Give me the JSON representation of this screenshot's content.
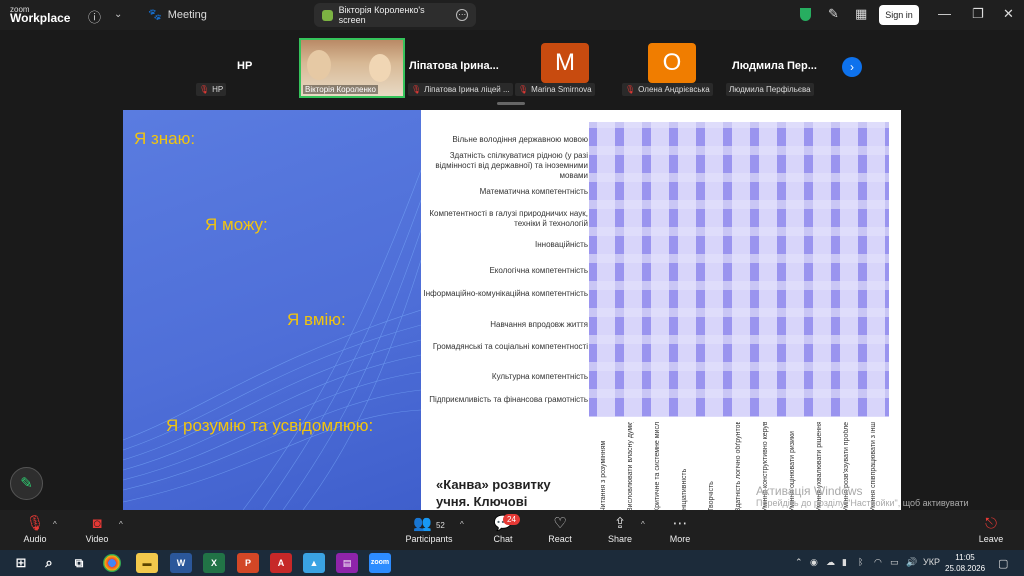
{
  "app": {
    "logo_top": "zoom",
    "logo_bottom": "Workplace",
    "meeting_label": "Meeting",
    "share_tab": "Вікторія Короленко's screen",
    "signin": "Sign in"
  },
  "participants": [
    {
      "tile_name": "HP",
      "tag": "HP"
    },
    {
      "tile_name": "",
      "tag": "Вікторія Короленко"
    },
    {
      "tile_name": "Ліпатова Ірина...",
      "tag": "Ліпатова Ірина ліцей ..."
    },
    {
      "tile_name": "",
      "tag": "Marina Smirnova",
      "initial": "M",
      "color": "#c84b0f"
    },
    {
      "tile_name": "",
      "tag": "Олена Андрієвська",
      "initial": "O",
      "color": "#f07d00"
    },
    {
      "tile_name": "Людмила Пер...",
      "tag": "Людмила Перфільєва"
    }
  ],
  "slide_left": {
    "phrases": [
      "Я знаю:",
      "Я можу:",
      "Я вмію:",
      "Я розумію та усвідомлюю:"
    ]
  },
  "slide_right": {
    "competences": [
      "Вільне володіння державною мовою",
      "Здатність спілкуватися рідною (у разі відмінності від державної) та іноземними мовами",
      "Математична компетентність",
      "Компетентності в галузі природничих наук, техніки й технологій",
      "Інноваційність",
      "Екологічна компетентність",
      "Інформаційно-комунікаційна компетентність",
      "Навчання впродовж життя",
      "Громадянські та соціальні компетентності",
      "Культурна компетентність",
      "Підприємливість та фінансова грамотність"
    ],
    "skills": [
      "Читання з розумінням",
      "Висловлювати власну думку усно та письмово",
      "Критичне та системне мислення",
      "Ініціативність",
      "Творчість",
      "Здатність логічно обґрунтовувати позицію",
      "Уміння конструктивно керувати емоціями",
      "Уміння оцінювати ризики",
      "Уміння ухвалювати рішення",
      "Уміння розв'язувати проблеми",
      "Уміння співпрацювати з іншими особами"
    ],
    "title": "«Канва» розвитку учня. Ключові"
  },
  "watermark": {
    "line1": "Активація Windows",
    "line2": "Перейдіть до розділу \"Настройки\", щоб активувати Windows."
  },
  "toolbar": {
    "audio": "Audio",
    "video": "Video",
    "participants": "Participants",
    "participants_count": "52",
    "chat": "Chat",
    "chat_badge": "24",
    "react": "React",
    "share": "Share",
    "more": "More",
    "leave": "Leave"
  },
  "taskbar": {
    "lang": "УКР",
    "time": "11:05",
    "date": "25.08.2026"
  }
}
